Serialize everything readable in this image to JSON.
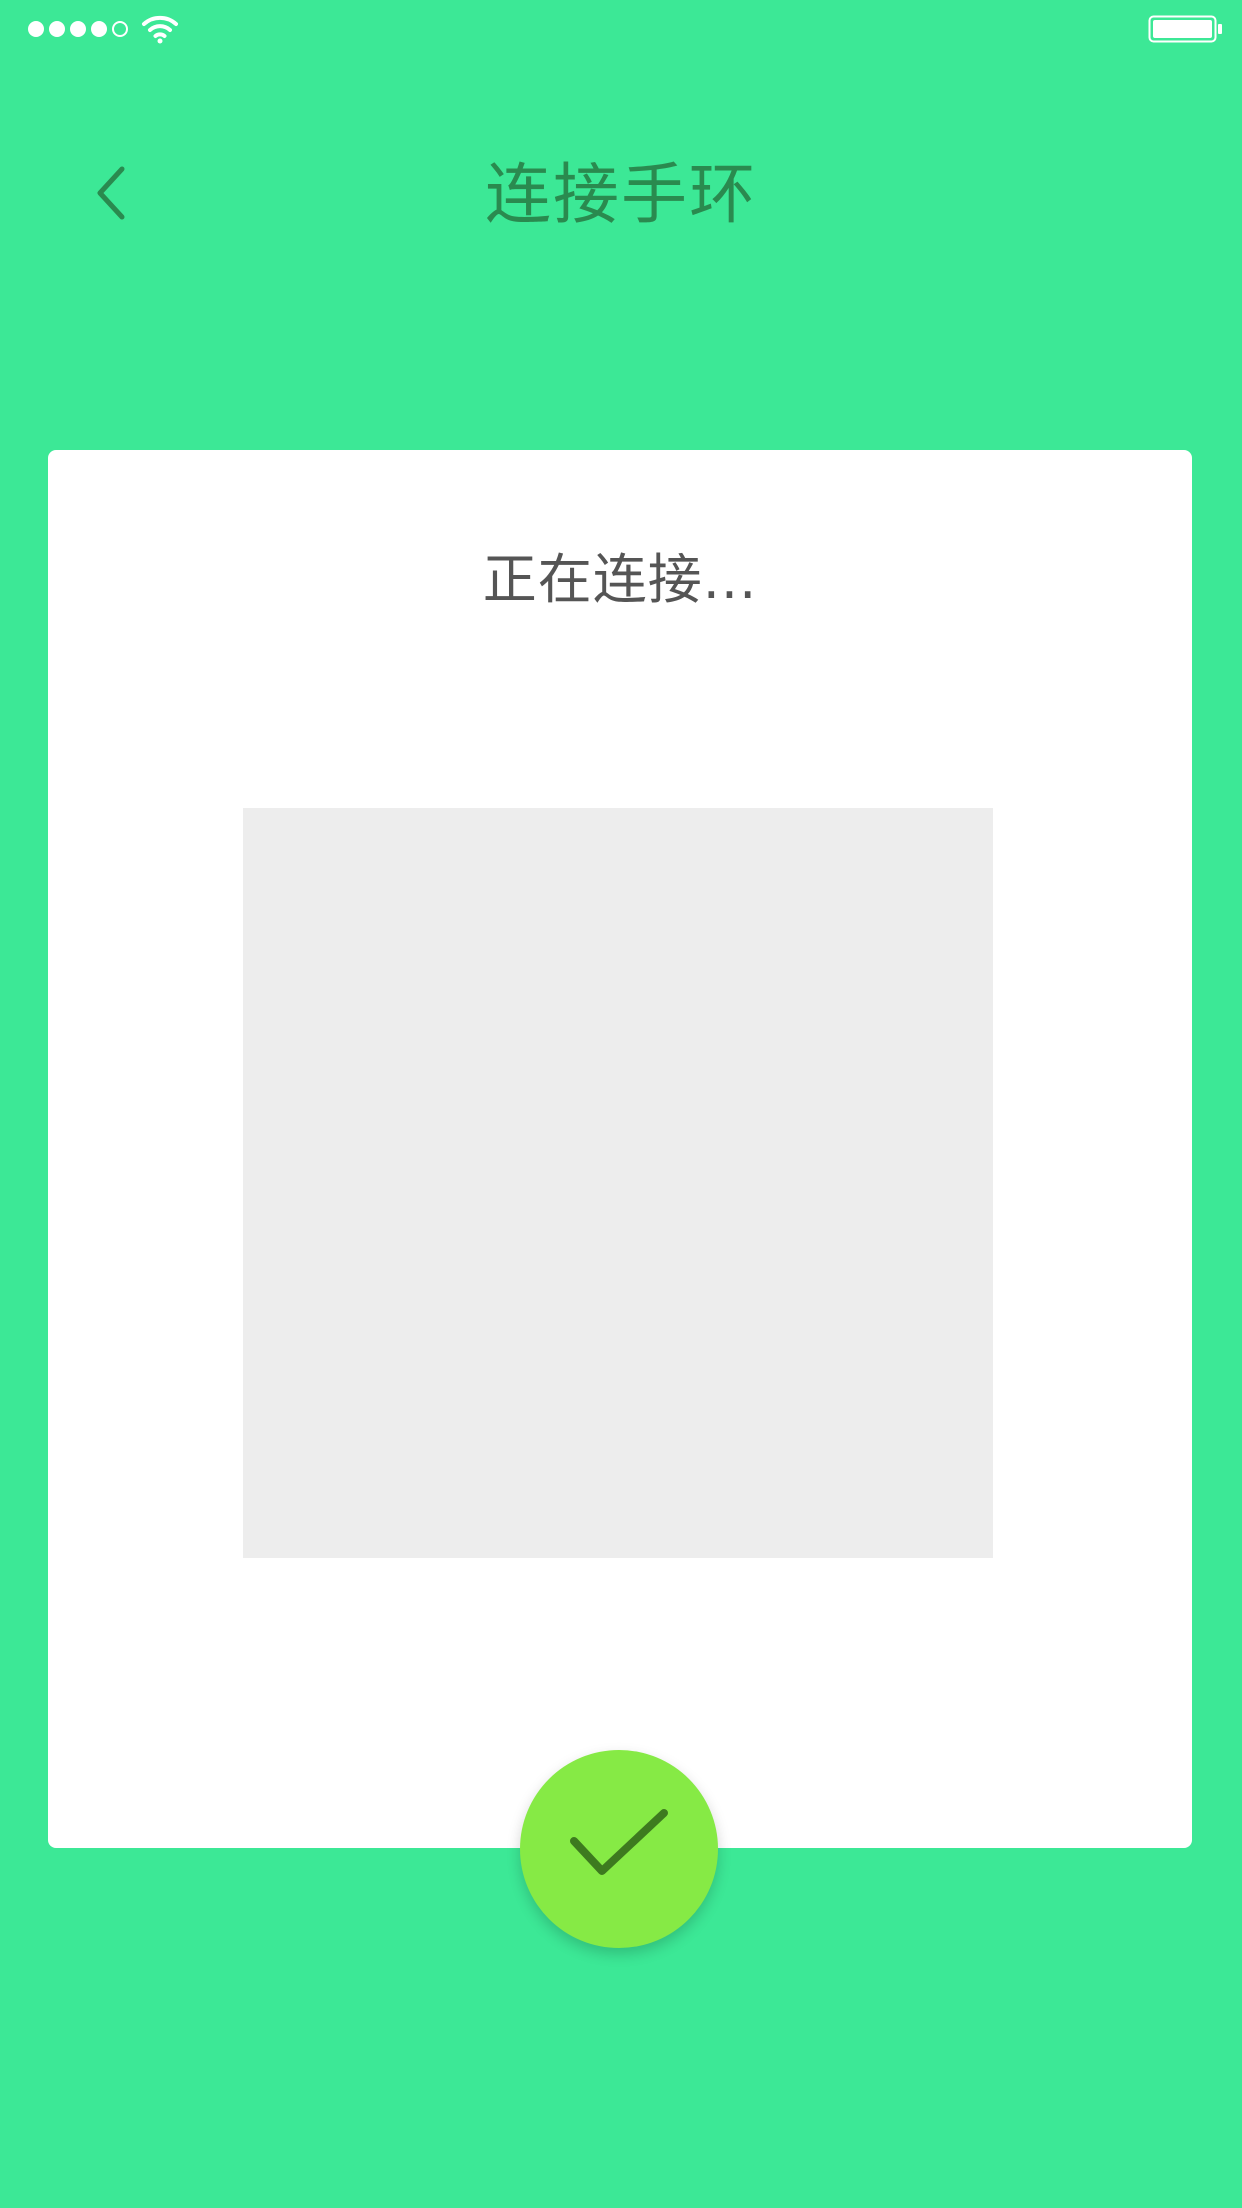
{
  "colors": {
    "background": "#3ce896",
    "card": "#ffffff",
    "title": "#2a8a4f",
    "status_text": "#555555",
    "placeholder": "#ededed",
    "confirm_fill": "#86ea45",
    "confirm_check": "#3d7a1f"
  },
  "status_bar": {
    "signal_icon": "signal-dots-icon",
    "wifi_icon": "wifi-icon",
    "battery_icon": "battery-icon"
  },
  "header": {
    "back_icon": "chevron-left-icon",
    "title": "连接手环"
  },
  "card": {
    "status_text": "正在连接...",
    "image_placeholder": "device-image-placeholder"
  },
  "confirm": {
    "icon": "checkmark-icon"
  }
}
